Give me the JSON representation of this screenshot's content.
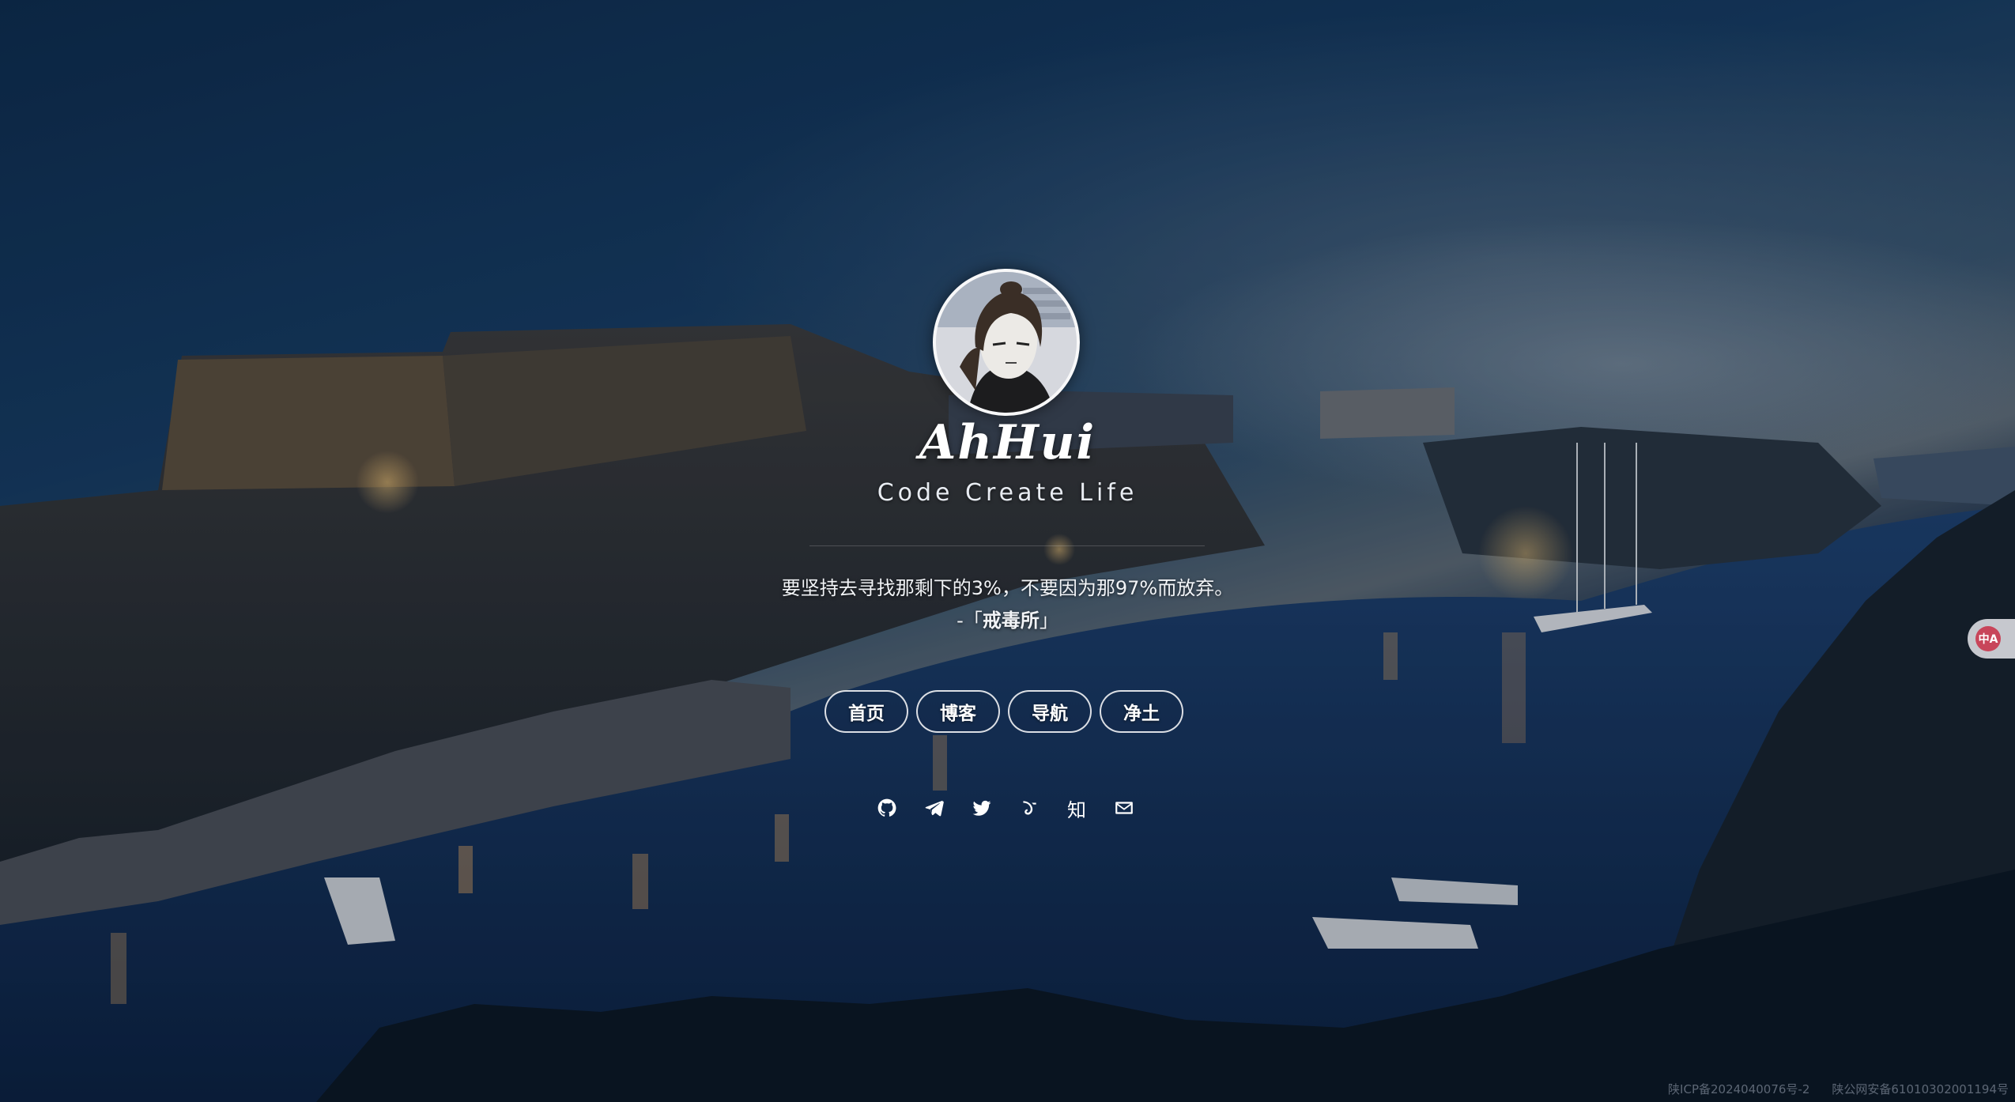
{
  "profile": {
    "name": "AhHui",
    "slogan": "Code Create Life"
  },
  "quote": {
    "text": "要坚持去寻找那剩下的3%，不要因为那97%而放弃。",
    "source_prefix": "-「",
    "source": "戒毒所",
    "source_suffix": "」"
  },
  "nav": {
    "items": [
      {
        "label": "首页"
      },
      {
        "label": "博客"
      },
      {
        "label": "导航"
      },
      {
        "label": "净土"
      }
    ]
  },
  "social": {
    "icons": [
      "github-icon",
      "telegram-icon",
      "twitter-icon",
      "fediverse-icon",
      "zhihu-icon",
      "email-icon"
    ],
    "zhihu_label": "知"
  },
  "translate": {
    "label": "中A"
  },
  "footer": {
    "icp": "陕ICP备2024040076号-2",
    "police": "陕公网安备61010302001194号"
  },
  "colors": {
    "accent": "#ffffff",
    "translate_badge": "#c8455a"
  }
}
